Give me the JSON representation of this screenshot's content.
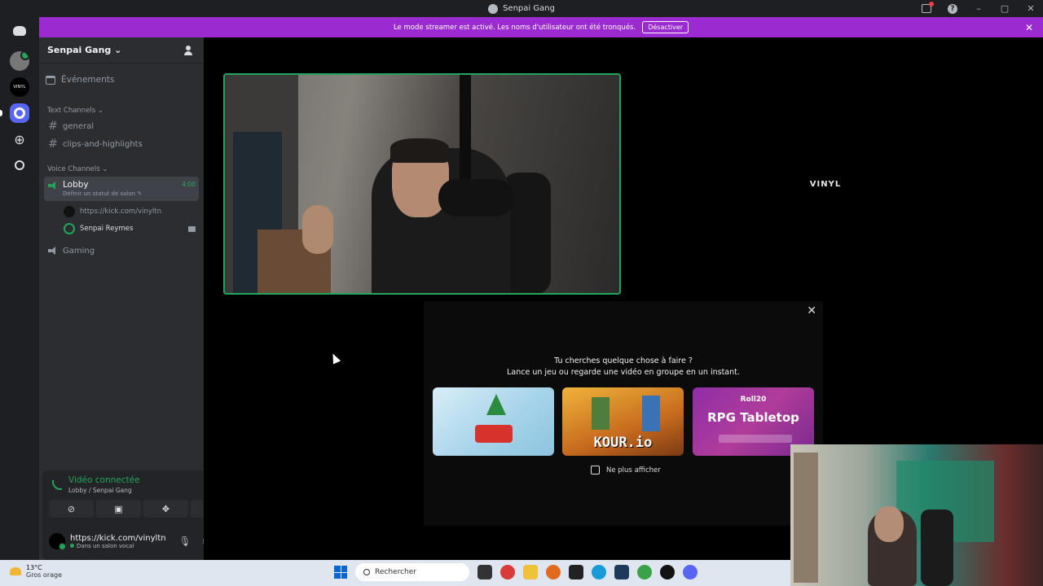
{
  "window": {
    "title": "Senpai Gang"
  },
  "banner": {
    "message": "Le mode streamer est activé. Les noms d'utilisateur ont été tronqués.",
    "button_label": "Désactiver"
  },
  "servers": {
    "s2_label": "VINYL"
  },
  "sidebar": {
    "guild_name": "Senpai Gang",
    "events_label": "Événements",
    "text_category": "Text Channels",
    "text_channels": [
      "general",
      "clips-and-highlights"
    ],
    "voice_category": "Voice Channels",
    "lobby": {
      "name": "Lobby",
      "status_prompt": "Définir un statut de salon",
      "timer": "4:00",
      "members": [
        "https://kick.com/vinyltn",
        "Senpai Reymes"
      ]
    },
    "gaming_channel": "Gaming"
  },
  "voice_panel": {
    "status": "Vidéo connectée",
    "location": "Lobby / Senpai Gang"
  },
  "user": {
    "name": "https://kick.com/vinyltn",
    "sub": "Dans un salon vocal"
  },
  "stage": {
    "vinyl_tile_label": "VINYL"
  },
  "activity": {
    "line1": "Tu cherches quelque chose à faire ?",
    "line2": "Lance un jeu ou regarde une vidéo en groupe en un instant.",
    "kour_label": "KOUR.io",
    "roll20_brand": "Roll20",
    "rpg_title": "RPG Tabletop",
    "dont_show": "Ne plus afficher"
  },
  "taskbar": {
    "temperature": "13°C",
    "condition": "Gros orage",
    "search_placeholder": "Rechercher"
  }
}
